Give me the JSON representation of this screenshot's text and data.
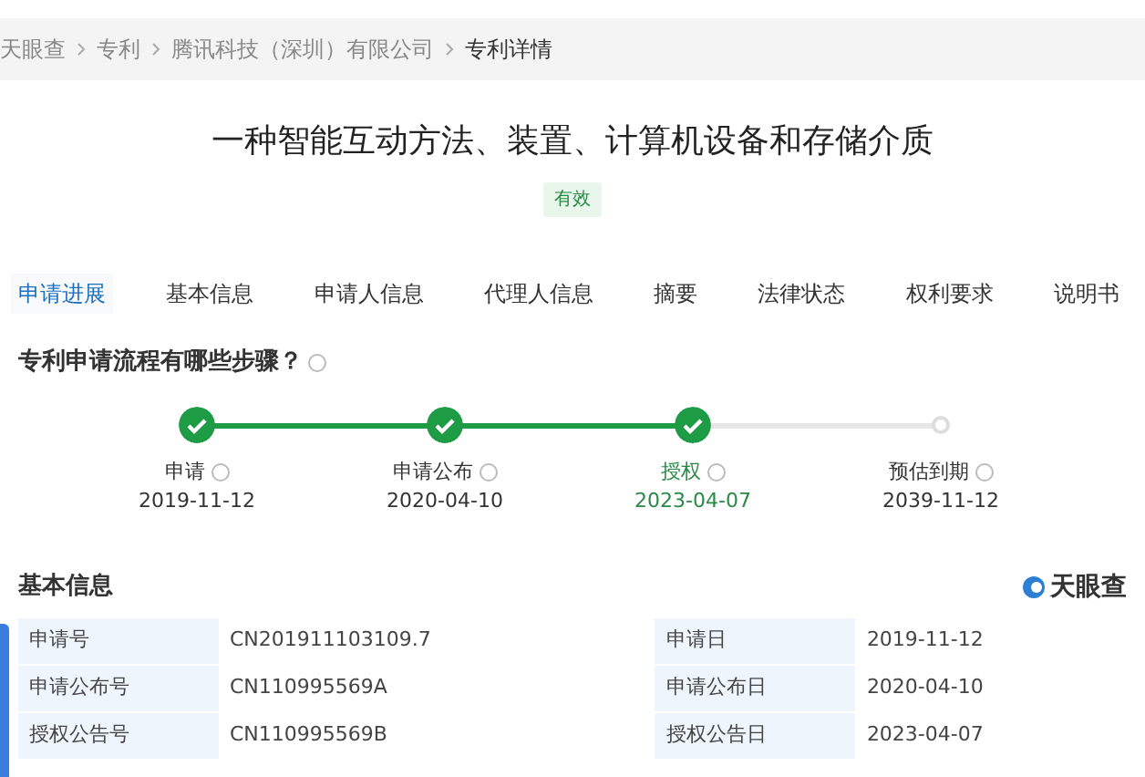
{
  "breadcrumb": [
    "天眼查",
    "专利",
    "腾讯科技（深圳）有限公司",
    "专利详情"
  ],
  "patent": {
    "title": "一种智能互动方法、装置、计算机设备和存储介质",
    "status": "有效"
  },
  "tabs": [
    {
      "label": "申请进展",
      "selected": true
    },
    {
      "label": "基本信息",
      "selected": false
    },
    {
      "label": "申请人信息",
      "selected": false
    },
    {
      "label": "代理人信息",
      "selected": false
    },
    {
      "label": "摘要",
      "selected": false
    },
    {
      "label": "法律状态",
      "selected": false
    },
    {
      "label": "权利要求",
      "selected": false
    },
    {
      "label": "说明书",
      "selected": false
    }
  ],
  "progress": {
    "heading": "专利申请流程有哪些步骤？",
    "steps": [
      {
        "label": "申请",
        "date": "2019-11-12",
        "done": true,
        "selected": false
      },
      {
        "label": "申请公布",
        "date": "2020-04-10",
        "done": true,
        "selected": false
      },
      {
        "label": "授权",
        "date": "2023-04-07",
        "done": true,
        "selected": true
      },
      {
        "label": "预估到期",
        "date": "2039-11-12",
        "done": false,
        "selected": false
      }
    ]
  },
  "basic_info": {
    "heading": "基本信息",
    "logo": "天眼查",
    "rows": [
      [
        "申请号",
        "CN201911103109.7",
        "申请日",
        "2019-11-12"
      ],
      [
        "申请公布号",
        "CN110995569A",
        "申请公布日",
        "2020-04-10"
      ],
      [
        "授权公告号",
        "CN110995569B",
        "授权公告日",
        "2023-04-07"
      ]
    ]
  }
}
